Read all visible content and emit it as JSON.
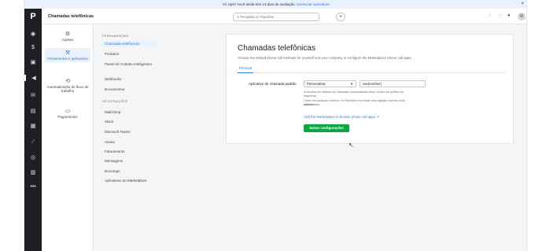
{
  "trial_banner": {
    "text": "Oi, tqriz! Você ainda tem 13 dias de avaliação.",
    "link": "Gerenciar assinatura",
    "close": "×"
  },
  "topbar": {
    "logo": "P",
    "page_name": "Chamadas telefônicas",
    "search_placeholder": "Pesquisar no Pipedrive",
    "add_label": "+",
    "avatar_initial": "R"
  },
  "subnav": {
    "items": [
      {
        "label": "Ajustes",
        "icon": "gear-icon"
      },
      {
        "label": "Ferramentas e aplicativos",
        "icon": "tools-icon"
      },
      {
        "label": "Automatização do fluxo de trabalho",
        "icon": "automation-icon"
      },
      {
        "label": "Pagamentos",
        "icon": "card-icon"
      }
    ]
  },
  "menu": {
    "tools_heading": "FERRAMENTAS",
    "tools": [
      "Chamadas telefônicas",
      "Produtos",
      "Painel de Contato Inteligentes",
      "Webhooks",
      "Documentos"
    ],
    "integrations_heading": "INTEGRAÇÕES",
    "integrations": [
      "Mailchimp",
      "Slack",
      "Microsoft Teams",
      "Asana",
      "Faturamento",
      "Mensagens",
      "DocuSign",
      "Aplicativos do Marketplace"
    ]
  },
  "card": {
    "title": "Chamadas telefônicas",
    "subtitle": "Choose the default phone call methods for yourself and your company or configure the Marketplace phone call apps.",
    "tab": "Pessoal",
    "field_label": "Aplicativo de chamada padrão",
    "select_value": "Personalizar",
    "input_value": "xsa{number}",
    "help_lines": [
      "A escolha do método de chamada personalizado deve conter um prefixo de",
      "esquema.",
      "Clicar em qualquer número no Pipedrive vai iniciar uma ligação usando esse método",
      "selecionado."
    ],
    "marketplace_link": "Visit the Marketplace to browse phone call apps ↗",
    "save_label": "Salvar configurações"
  },
  "colors": {
    "accent": "#317ae2",
    "save_green": "#08a742",
    "rail_bg": "#1e1f24"
  }
}
